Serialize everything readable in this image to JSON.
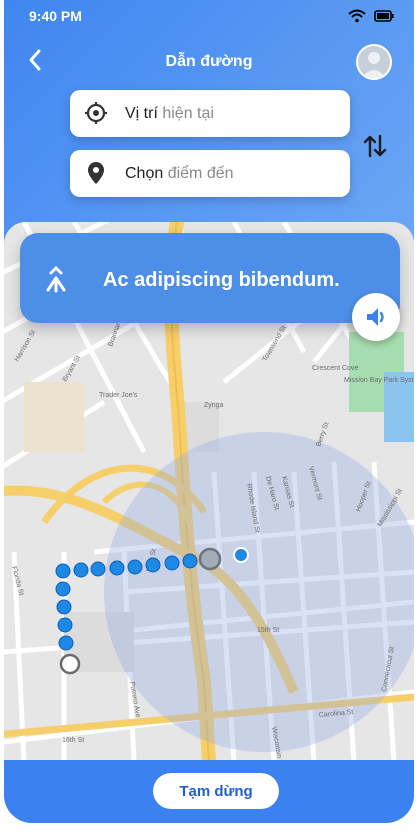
{
  "status": {
    "time": "9:40 PM"
  },
  "header": {
    "title": "Dẫn đường"
  },
  "origin": {
    "label": "Vị trí",
    "placeholder": "hiện tại"
  },
  "destination": {
    "label": "Chọn",
    "placeholder": "điểm đến"
  },
  "instruction": {
    "text": "Ac adipiscing bibendum."
  },
  "map": {
    "street_labels": [
      "Trader Joe's",
      "Zynga",
      "Crescent Cove",
      "Mission Bay Park System",
      "Harrison St",
      "Bryant St",
      "Brannan St",
      "Townsend St",
      "De Haro St",
      "Rhode Island St",
      "Kansas St",
      "Vermont St",
      "Hooper St",
      "Berry St",
      "Mississippi St",
      "Connecticut St",
      "Potrero Ave",
      "Utah St",
      "Florida St",
      "15th St",
      "16th St",
      "Carolina St",
      "Wisconsin St"
    ]
  },
  "footer": {
    "pause_label": "Tạm dừng"
  },
  "colors": {
    "accent": "#3b82f0",
    "banner": "#4d8ee8",
    "route": "#1e88e5"
  }
}
